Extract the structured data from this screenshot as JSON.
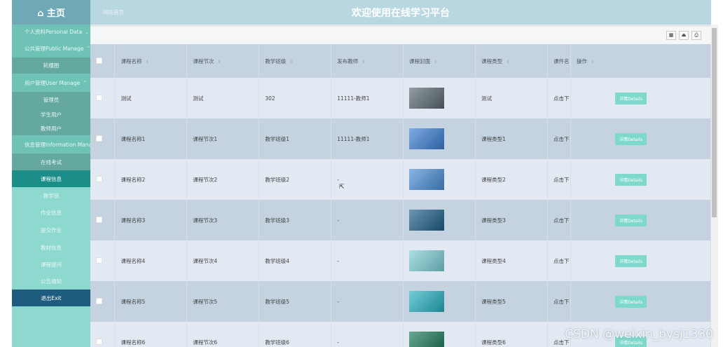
{
  "sidebar": {
    "logo": "⌂ 主页",
    "items": [
      {
        "label": "个人资料Personal Data",
        "kind": "group",
        "chev": "⌄"
      },
      {
        "label": "公共管理Public Manage",
        "kind": "group",
        "chev": "⌃"
      },
      {
        "label": "轮播图",
        "kind": "sub"
      },
      {
        "label": "用户管理User Manage",
        "kind": "group",
        "chev": "⌃"
      },
      {
        "label": "管理员",
        "kind": "sub"
      },
      {
        "label": "学生用户",
        "kind": "sub"
      },
      {
        "label": "教师用户",
        "kind": "sub"
      },
      {
        "label": "信息管理Information Manage",
        "kind": "group",
        "chev": "⌃"
      },
      {
        "label": "在线考试",
        "kind": "sub"
      },
      {
        "label": "课程信息",
        "kind": "active"
      },
      {
        "label": "教学班",
        "kind": "plain"
      },
      {
        "label": "作业信息",
        "kind": "plain"
      },
      {
        "label": "提交作业",
        "kind": "plain"
      },
      {
        "label": "教材信息",
        "kind": "plain"
      },
      {
        "label": "课程提问",
        "kind": "plain"
      },
      {
        "label": "公告通知",
        "kind": "plain"
      },
      {
        "label": "退出Exit",
        "kind": "exit"
      }
    ]
  },
  "header": {
    "breadcrumb": "网站首页",
    "title": "欢迎使用在线学习平台"
  },
  "toolbar": {
    "buttons": [
      {
        "name": "columns-icon",
        "glyph": "▦"
      },
      {
        "name": "export-icon",
        "glyph": "⏏"
      },
      {
        "name": "print-icon",
        "glyph": "⎙"
      }
    ]
  },
  "table": {
    "sort_glyph": "⇕",
    "columns": [
      "课程名称",
      "课程节次",
      "教学班级",
      "发布教师",
      "课程封面",
      "课程类型",
      "课件名",
      "操作"
    ],
    "detail_label": "详情Details",
    "rows": [
      {
        "name": "测试",
        "section": "测试",
        "class": "302",
        "teacher": "11111-教师1",
        "type": "测试",
        "file": "点击下",
        "cover": "#5a6b72"
      },
      {
        "name": "课程名称1",
        "section": "课程节次1",
        "class": "教学班级1",
        "teacher": "11111-教师1",
        "type": "课程类型1",
        "file": "点击下",
        "cover": "#3b7fd6"
      },
      {
        "name": "课程名称2",
        "section": "课程节次2",
        "class": "教学班级2",
        "teacher": "-",
        "type": "课程类型2",
        "file": "点击下",
        "cover": "#4a8fd8"
      },
      {
        "name": "课程名称3",
        "section": "课程节次3",
        "class": "教学班级3",
        "teacher": "-",
        "type": "课程类型3",
        "file": "点击下",
        "cover": "#1f5f8a"
      },
      {
        "name": "课程名称4",
        "section": "课程节次4",
        "class": "教学班级4",
        "teacher": "-",
        "type": "课程类型4",
        "file": "点击下",
        "cover": "#7fd0d8"
      },
      {
        "name": "课程名称5",
        "section": "课程节次5",
        "class": "教学班级5",
        "teacher": "-",
        "type": "课程类型5",
        "file": "点击下",
        "cover": "#27b3c2"
      },
      {
        "name": "课程名称6",
        "section": "课程节次6",
        "class": "教学班级6",
        "teacher": "-",
        "type": "课程类型6",
        "file": "点击下",
        "cover": "#1a7a5a"
      }
    ]
  },
  "watermark": "CSDN @weixin_bysj1330"
}
